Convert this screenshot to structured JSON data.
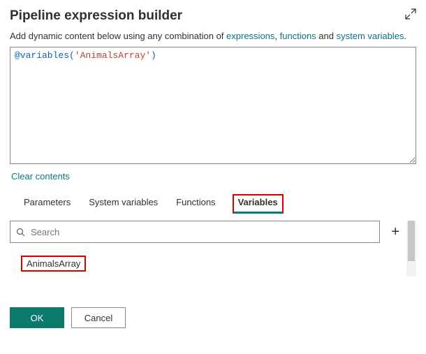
{
  "header": {
    "title": "Pipeline expression builder",
    "subtext_prefix": "Add dynamic content below using any combination of ",
    "link_expressions": "expressions",
    "link_functions": "functions",
    "subtext_and": " and ",
    "link_sysvars": "system variables",
    "subtext_period": "."
  },
  "editor": {
    "invoke": "@variables",
    "open": "(",
    "string": "'AnimalsArray'",
    "close": ")"
  },
  "clear_label": "Clear contents",
  "tabs": {
    "parameters": "Parameters",
    "system_variables": "System variables",
    "functions": "Functions",
    "variables": "Variables"
  },
  "search": {
    "placeholder": "Search"
  },
  "plus_label": "+",
  "variable_item": "AnimalsArray",
  "footer": {
    "ok": "OK",
    "cancel": "Cancel"
  },
  "comma_sep": ", "
}
